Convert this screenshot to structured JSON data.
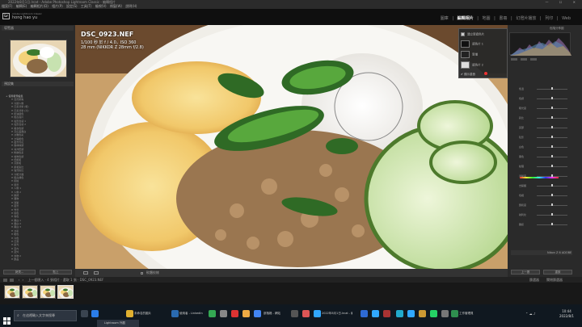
{
  "window": {
    "title": "2022年8月1日.lrcat - Adobe Photoshop Lightroom Classic - 編輯相片"
  },
  "menu": [
    "檔案(F)",
    "編輯(E)",
    "編輯相片(D)",
    "相片(P)",
    "設定(S)",
    "工具(T)",
    "檢視(V)",
    "視窗(W)",
    "說明(H)"
  ],
  "identity": {
    "line1": "Adobe Lightroom Classic",
    "line2": "hong hao yu"
  },
  "modules": [
    "圖庫",
    "編輯相片",
    "地圖",
    "書冊",
    "幻燈片播放",
    "列印",
    "Web"
  ],
  "active_module": "編輯相片",
  "photo": {
    "filename": "DSC_0923.NEF",
    "exposure": "1/100 秒 於 f / 4.0，ISO 360",
    "lens": "28 mm (NIKKOR Z 28mm f/2.8)"
  },
  "left_panel": {
    "navigator_label": "導覽器",
    "presets_label": "預設集",
    "presets": [
      {
        "label": "+ 使用者預設集",
        "folder": true
      },
      {
        "label": "H 自然柔焦",
        "folder": false
      },
      {
        "label": "H 冷調人像",
        "folder": false
      },
      {
        "label": "H 日系清新 (暖)",
        "folder": false
      },
      {
        "label": "H 日系清新 (冷)",
        "folder": false
      },
      {
        "label": "H 奶油膚色",
        "folder": false
      },
      {
        "label": "H 復古底片",
        "folder": false
      },
      {
        "label": "H 電影質感 1",
        "folder": false
      },
      {
        "label": "H 電影質感 2",
        "folder": false
      },
      {
        "label": "H 美食色調",
        "folder": false
      },
      {
        "label": "H 高反差黑白",
        "folder": false
      },
      {
        "label": "H 淡雅色彩",
        "folder": false
      },
      {
        "label": "H 夕陽暖色",
        "folder": false
      },
      {
        "label": "H 夜景霓虹",
        "folder": false
      },
      {
        "label": "H 森林綠調",
        "folder": false
      },
      {
        "label": "H 海洋藍調",
        "folder": false
      },
      {
        "label": "H 粉嫩色系",
        "folder": false
      },
      {
        "label": "H 咖啡色調",
        "folder": false
      },
      {
        "label": "H 低飽和",
        "folder": false
      },
      {
        "label": "H 高飽和",
        "folder": false
      },
      {
        "label": "H 柔和對比",
        "folder": false
      },
      {
        "label": "H 強烈對比",
        "folder": false
      },
      {
        "label": "H 冷暖分離",
        "folder": false
      },
      {
        "label": "H 復古褪色",
        "folder": false
      },
      {
        "label": "H 街拍",
        "folder": false
      },
      {
        "label": "H 風景",
        "folder": false
      },
      {
        "label": "H 人像 1",
        "folder": false
      },
      {
        "label": "H 人像 2",
        "folder": false
      },
      {
        "label": "H 婚禮",
        "folder": false
      },
      {
        "label": "H 寵物",
        "folder": false
      },
      {
        "label": "H 建築",
        "folder": false
      },
      {
        "label": "H 夜景",
        "folder": false
      },
      {
        "label": "H 雪景",
        "folder": false
      },
      {
        "label": "H 秋色",
        "folder": false
      },
      {
        "label": "H 春色",
        "folder": false
      },
      {
        "label": "H 黑白 1",
        "folder": false
      },
      {
        "label": "H 黑白 2",
        "folder": false
      },
      {
        "label": "H 黑白 3",
        "folder": false
      },
      {
        "label": "H 淡彩",
        "folder": false
      },
      {
        "label": "H 暖色",
        "folder": false
      },
      {
        "label": "H 冷色",
        "folder": false
      },
      {
        "label": "H 日落",
        "folder": false
      },
      {
        "label": "H 晨光",
        "folder": false
      },
      {
        "label": "H 室內",
        "folder": false
      },
      {
        "label": "H 室外",
        "folder": false
      },
      {
        "label": "H 食物 2",
        "folder": false
      },
      {
        "label": "H 飲品",
        "folder": false
      }
    ],
    "copy_button": "拷貝...",
    "paste_button": "貼上"
  },
  "mask_panel": {
    "title": "建立新遮色片",
    "items": [
      "遮色片 1",
      "新增",
      "遮色片 2"
    ],
    "show_overlay": "顯示重疊"
  },
  "toolbar": {
    "label": "軟體校樣"
  },
  "right_panel": {
    "histogram_label": "色階分佈圖",
    "sliders": [
      {
        "label": "色溫",
        "value": 0.5
      },
      {
        "label": "色調",
        "value": 0.5
      },
      {
        "label": "曝光度",
        "value": 0.5
      },
      {
        "label": "對比",
        "value": 0.5
      },
      {
        "label": "亮部",
        "value": 0.5
      },
      {
        "label": "陰影",
        "value": 0.5
      },
      {
        "label": "白色",
        "value": 0.5
      },
      {
        "label": "黑色",
        "value": 0.5
      },
      {
        "label": "紋理",
        "value": 0.5
      },
      {
        "label": "清晰度",
        "value": 0.5
      },
      {
        "label": "去朦朧",
        "value": 0.5
      },
      {
        "label": "色相",
        "value": 0.5
      },
      {
        "label": "飽和度",
        "value": 0.5
      },
      {
        "label": "銳利化",
        "value": 0.5
      },
      {
        "label": "雜訊",
        "value": 0.5
      }
    ],
    "profile_label": "Nikon Z 6 ADOBE",
    "prev_button": "上一張",
    "reset_button": "重設"
  },
  "filmstrip": {
    "path": "上一個匯入 · 4 張相片 · 選取 1 張 · DSC_0923.NEF",
    "filter_label": "篩選器",
    "filter_value": "關閉篩選器",
    "thumb_count": 4
  },
  "taskbar": {
    "search_placeholder": "在這裡輸入文字來搜尋",
    "apps": [
      "未命名的圖片",
      "使用者 - LinkedIn",
      "部落格 - 網站",
      "2022年8月1日.lrcat - 編輯",
      "工作管理員"
    ],
    "preview": "Lightroom 外觀",
    "time": "10:44",
    "date": "2022/8/1"
  }
}
